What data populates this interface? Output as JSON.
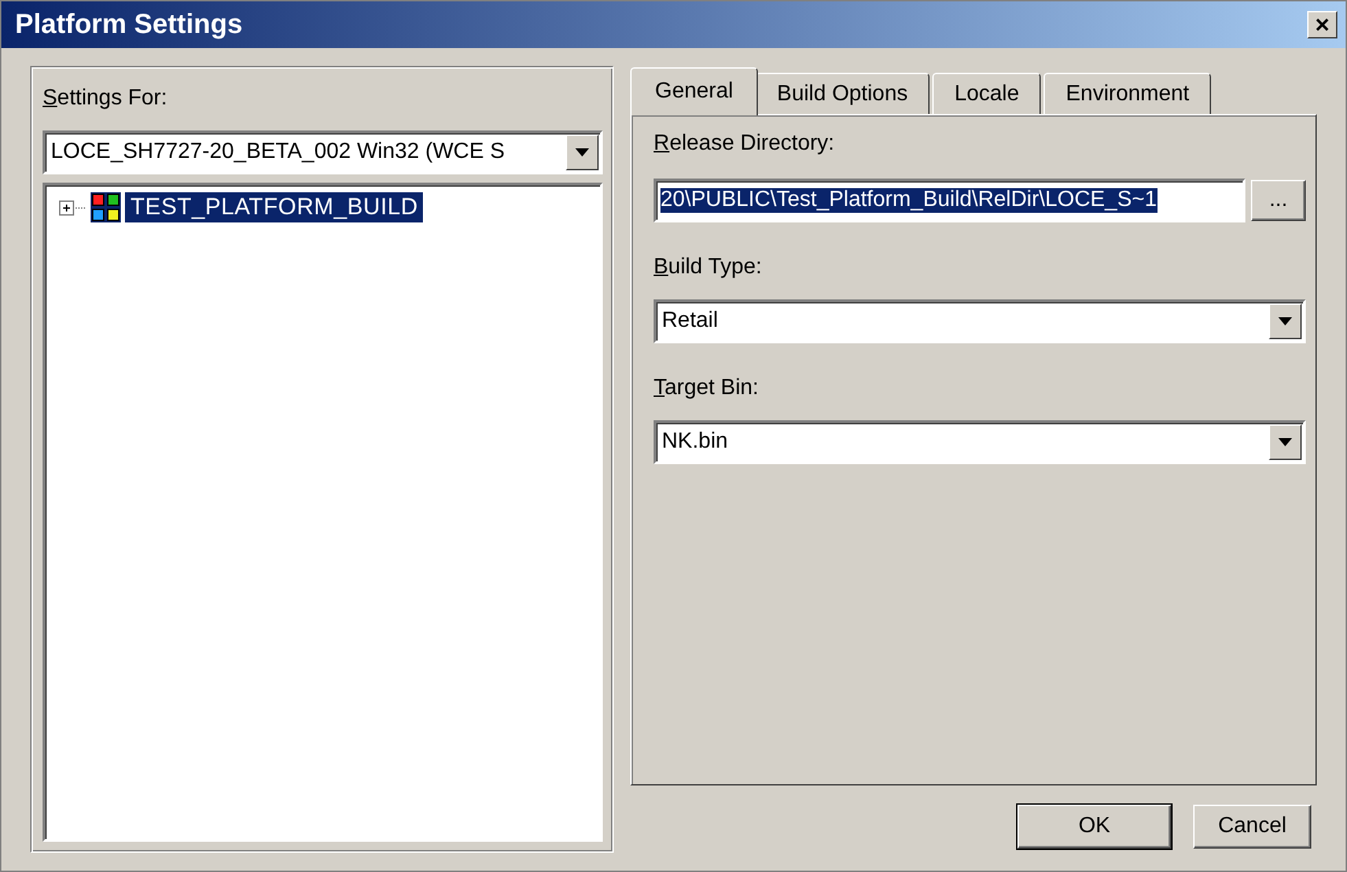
{
  "window": {
    "title": "Platform Settings",
    "close": "×"
  },
  "settings_for": {
    "label": "Settings For:",
    "value": "LOCE_SH7727-20_BETA_002 Win32 (WCE S"
  },
  "tree": {
    "items": [
      {
        "label": "TEST_PLATFORM_BUILD",
        "selected": true,
        "expanded": false
      }
    ]
  },
  "tabs": [
    {
      "label": "General",
      "selected": true
    },
    {
      "label": "Build Options",
      "selected": false
    },
    {
      "label": "Locale",
      "selected": false
    },
    {
      "label": "Environment",
      "selected": false
    }
  ],
  "release_directory": {
    "label": "Release Directory:",
    "value": "20\\PUBLIC\\Test_Platform_Build\\RelDir\\LOCE_S~1",
    "text_selected": true,
    "browse": "..."
  },
  "build_type": {
    "label": "Build Type:",
    "value": "Retail"
  },
  "target_bin": {
    "label": "Target Bin:",
    "value": "NK.bin"
  },
  "buttons": [
    {
      "label": "OK",
      "default": true
    },
    {
      "label": "Cancel",
      "default": false
    }
  ]
}
